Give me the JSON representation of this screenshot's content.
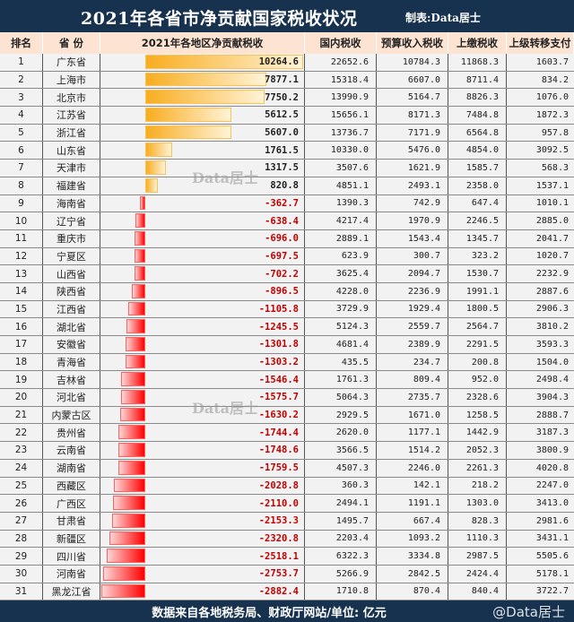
{
  "title": "2021年各省市净贡献国家税收状况",
  "maker": "制表:Data居士",
  "watermark": "Data居士",
  "corner_watermark": "@Data居士",
  "footer": "数据来自各地税务局、财政厅网站/单位: 亿元",
  "colors": {
    "header_bg": "#17324f",
    "col_header_bg": "#fde3d2",
    "positive_bar": "#f8ad20",
    "negative_bar": "#ff0000",
    "negative_text": "#c00000"
  },
  "chart_data": {
    "type": "table",
    "columns": [
      "排名",
      "省 份",
      "2021年各地区净贡献税收",
      "国内税收",
      "预算收入税收",
      "上缴税收",
      "上级转移支付"
    ],
    "rows": [
      [
        "1",
        "广东省",
        10264.6,
        "22652.6",
        "10784.3",
        "11868.3",
        "1603.7"
      ],
      [
        "2",
        "上海市",
        7877.1,
        "15318.4",
        "6607.0",
        "8711.4",
        "834.2"
      ],
      [
        "3",
        "北京市",
        7750.2,
        "13990.9",
        "5164.7",
        "8826.3",
        "1076.0"
      ],
      [
        "4",
        "江苏省",
        5612.5,
        "15656.1",
        "8171.3",
        "7484.8",
        "1872.3"
      ],
      [
        "5",
        "浙江省",
        5607.0,
        "13736.7",
        "7171.9",
        "6564.8",
        "957.8"
      ],
      [
        "6",
        "山东省",
        1761.5,
        "10330.0",
        "5476.0",
        "4854.0",
        "3092.5"
      ],
      [
        "7",
        "天津市",
        1317.5,
        "3507.6",
        "1621.9",
        "1585.7",
        "568.3"
      ],
      [
        "8",
        "福建省",
        820.8,
        "4851.1",
        "2493.1",
        "2358.0",
        "1537.1"
      ],
      [
        "9",
        "海南省",
        -362.7,
        "1390.3",
        "742.9",
        "647.4",
        "1010.1"
      ],
      [
        "10",
        "辽宁省",
        -638.4,
        "4217.4",
        "1970.9",
        "2246.5",
        "2885.0"
      ],
      [
        "11",
        "重庆市",
        -696.0,
        "2889.1",
        "1543.4",
        "1345.7",
        "2041.7"
      ],
      [
        "12",
        "宁夏区",
        -697.5,
        "623.9",
        "300.7",
        "323.2",
        "1020.7"
      ],
      [
        "13",
        "山西省",
        -702.2,
        "3625.4",
        "2094.7",
        "1530.7",
        "2232.9"
      ],
      [
        "14",
        "陕西省",
        -896.5,
        "4228.0",
        "2236.9",
        "1991.1",
        "2887.6"
      ],
      [
        "15",
        "江西省",
        -1105.8,
        "3729.9",
        "1929.4",
        "1800.5",
        "2906.3"
      ],
      [
        "16",
        "湖北省",
        -1245.5,
        "5124.3",
        "2559.7",
        "2564.7",
        "3810.2"
      ],
      [
        "17",
        "安徽省",
        -1301.8,
        "4681.4",
        "2389.9",
        "2291.5",
        "3593.3"
      ],
      [
        "18",
        "青海省",
        -1303.2,
        "435.5",
        "234.7",
        "200.8",
        "1504.0"
      ],
      [
        "19",
        "吉林省",
        -1546.4,
        "1761.3",
        "809.4",
        "952.0",
        "2498.4"
      ],
      [
        "20",
        "河北省",
        -1575.7,
        "5064.3",
        "2735.7",
        "2328.6",
        "3904.3"
      ],
      [
        "21",
        "内蒙古区",
        -1630.2,
        "2929.5",
        "1671.0",
        "1258.5",
        "2888.7"
      ],
      [
        "22",
        "贵州省",
        -1744.4,
        "2620.0",
        "1177.1",
        "1442.9",
        "3187.3"
      ],
      [
        "23",
        "云南省",
        -1748.6,
        "3566.5",
        "1514.2",
        "2052.3",
        "3800.9"
      ],
      [
        "24",
        "湖南省",
        -1759.5,
        "4507.3",
        "2246.0",
        "2261.3",
        "4020.8"
      ],
      [
        "25",
        "西藏区",
        -2028.8,
        "360.3",
        "142.1",
        "218.2",
        "2247.0"
      ],
      [
        "26",
        "广西区",
        -2110.0,
        "2494.1",
        "1191.1",
        "1303.0",
        "3413.0"
      ],
      [
        "27",
        "甘肃省",
        -2153.3,
        "1495.7",
        "667.4",
        "828.3",
        "2981.6"
      ],
      [
        "28",
        "新疆区",
        -2320.8,
        "2203.4",
        "1093.2",
        "1110.3",
        "3431.1"
      ],
      [
        "29",
        "四川省",
        -2518.1,
        "6322.3",
        "3334.8",
        "2987.5",
        "5505.6"
      ],
      [
        "30",
        "河南省",
        -2753.7,
        "5266.9",
        "2842.5",
        "2424.4",
        "5178.1"
      ],
      [
        "31",
        "黑龙江省",
        -2882.4,
        "1710.8",
        "870.4",
        "840.4",
        "3722.7"
      ]
    ]
  }
}
